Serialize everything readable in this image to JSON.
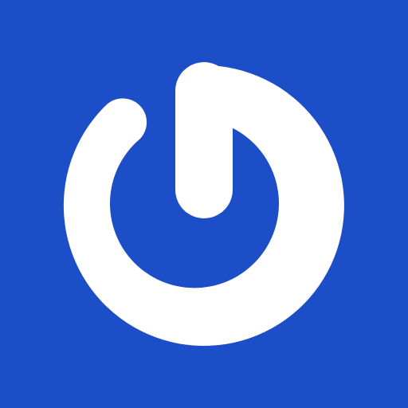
{
  "app_icon": {
    "icon": "power-icon",
    "background_color": "#1c4ec7",
    "glyph_color": "#ffffff"
  }
}
